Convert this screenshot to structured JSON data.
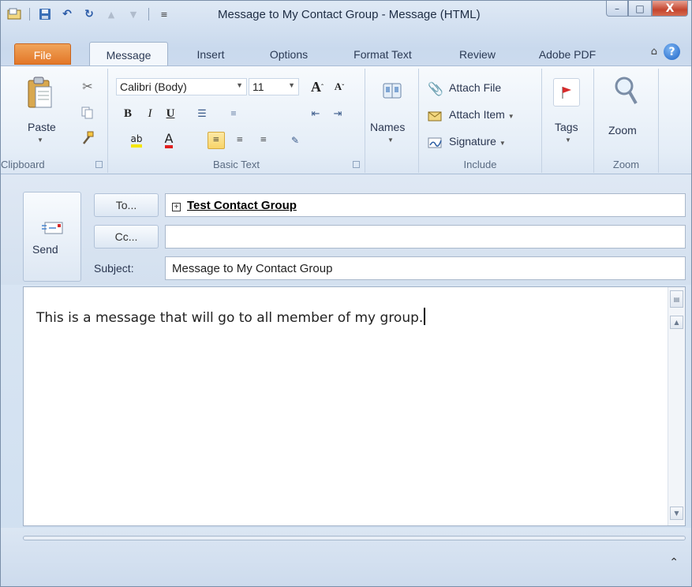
{
  "window": {
    "title": "Message to My Contact Group  -  Message (HTML)",
    "minimize": "–",
    "maximize": "□",
    "close": "X"
  },
  "tabs": {
    "file": "File",
    "message": "Message",
    "insert": "Insert",
    "options": "Options",
    "format_text": "Format Text",
    "review": "Review",
    "adobe_pdf": "Adobe PDF"
  },
  "ribbon": {
    "clipboard": {
      "label": "Clipboard",
      "paste": "Paste"
    },
    "basic_text": {
      "label": "Basic Text",
      "font": "Calibri (Body)",
      "size": "11",
      "bold": "B",
      "italic": "I",
      "underline": "U"
    },
    "names": {
      "label": "Names"
    },
    "include": {
      "label": "Include",
      "attach_file": "Attach File",
      "attach_item": "Attach Item",
      "signature": "Signature"
    },
    "tags": {
      "label": "Tags"
    },
    "zoom": {
      "label": "Zoom",
      "button": "Zoom"
    }
  },
  "header": {
    "send": "Send",
    "to_button": "To...",
    "cc_button": "Cc...",
    "subject_label": "Subject:",
    "to_value": "Test Contact Group",
    "cc_value": "",
    "subject_value": "Message to My Contact Group"
  },
  "body": {
    "text": "This is a message that will go to all member of my group."
  },
  "colors": {
    "file_tab": "#e37728",
    "close_button": "#c4452e",
    "highlight": "#f8d46a"
  }
}
